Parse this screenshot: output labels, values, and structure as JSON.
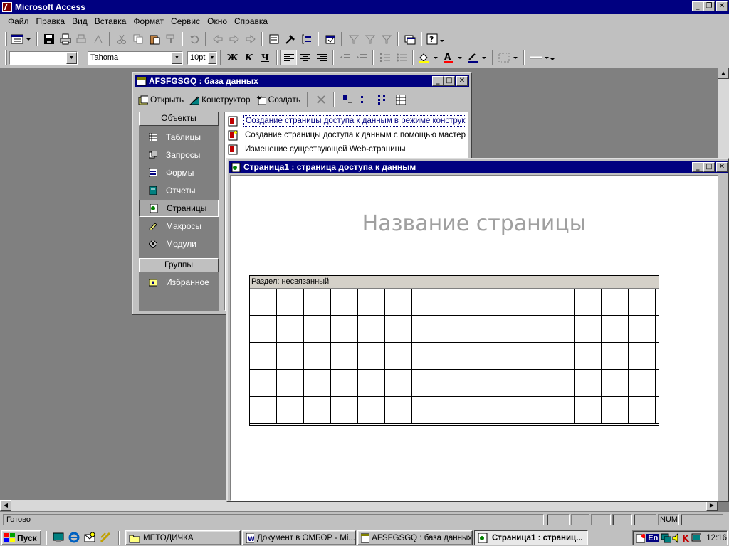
{
  "app": {
    "title": "Microsoft Access"
  },
  "window_buttons": {
    "minimize": "_",
    "restore": "❐",
    "close": "✕"
  },
  "menu": [
    "Файл",
    "Правка",
    "Вид",
    "Вставка",
    "Формат",
    "Сервис",
    "Окно",
    "Справка"
  ],
  "format_toolbar": {
    "object_combo": "",
    "font_combo": "Tahoma",
    "size_combo": "10pt",
    "bold": "Ж",
    "italic": "К",
    "underline": "Ч"
  },
  "db_window": {
    "title": "AFSFGSGQ : база данных",
    "toolbar": {
      "open": "Открыть",
      "design": "Конструктор",
      "create": "Создать"
    },
    "objects_header": "Объекты",
    "objects": [
      "Таблицы",
      "Запросы",
      "Формы",
      "Отчеты",
      "Страницы",
      "Макросы",
      "Модули"
    ],
    "selected_object": "Страницы",
    "groups_header": "Группы",
    "groups": [
      "Избранное"
    ],
    "list": [
      "Создание страницы доступа к данным в режиме конструктора",
      "Создание страницы доступа к данным с помощью мастера",
      "Изменение существующей Web-страницы"
    ]
  },
  "page_window": {
    "title": "Страница1 : страница доступа к данным",
    "page_title": "Название страницы",
    "section_header": "Раздел: несвязанный"
  },
  "status": {
    "text": "Готово",
    "num": "NUM"
  },
  "taskbar": {
    "start": "Пуск",
    "tasks": [
      {
        "label": "МЕТОДИЧКА",
        "active": false
      },
      {
        "label": "Документ в ОМБОР - Mi...",
        "active": false
      },
      {
        "label": "AFSFGSGQ : база данных",
        "active": false
      },
      {
        "label": "Страница1 : страниц...",
        "active": true
      }
    ],
    "lang": "En",
    "clock": "12:16"
  },
  "colors": {
    "title_bar": "#000080",
    "desktop": "#808080",
    "face": "#c0c0c0"
  }
}
